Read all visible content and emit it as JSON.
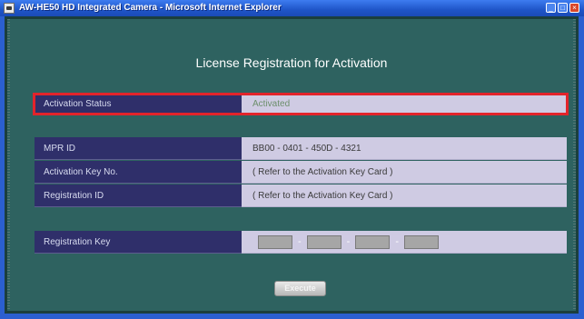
{
  "window": {
    "title": "AW-HE50 HD Integrated Camera - Microsoft Internet Explorer",
    "controls": [
      "_",
      "□",
      "×"
    ]
  },
  "page": {
    "title": "License Registration for Activation"
  },
  "status": {
    "label": "Activation Status",
    "value": "Activated",
    "highlight_color": "#e2242b"
  },
  "info": {
    "mpr_label": "MPR ID",
    "mpr_value": "BB00 - 0401 - 450D - 4321",
    "activation_key_label": "Activation Key No.",
    "activation_key_value": "( Refer to the Activation Key Card )",
    "registration_id_label": "Registration ID",
    "registration_id_value": "( Refer to the Activation Key Card )"
  },
  "registration": {
    "label": "Registration Key",
    "separator": "-"
  },
  "actions": {
    "execute_label": "Execute"
  }
}
